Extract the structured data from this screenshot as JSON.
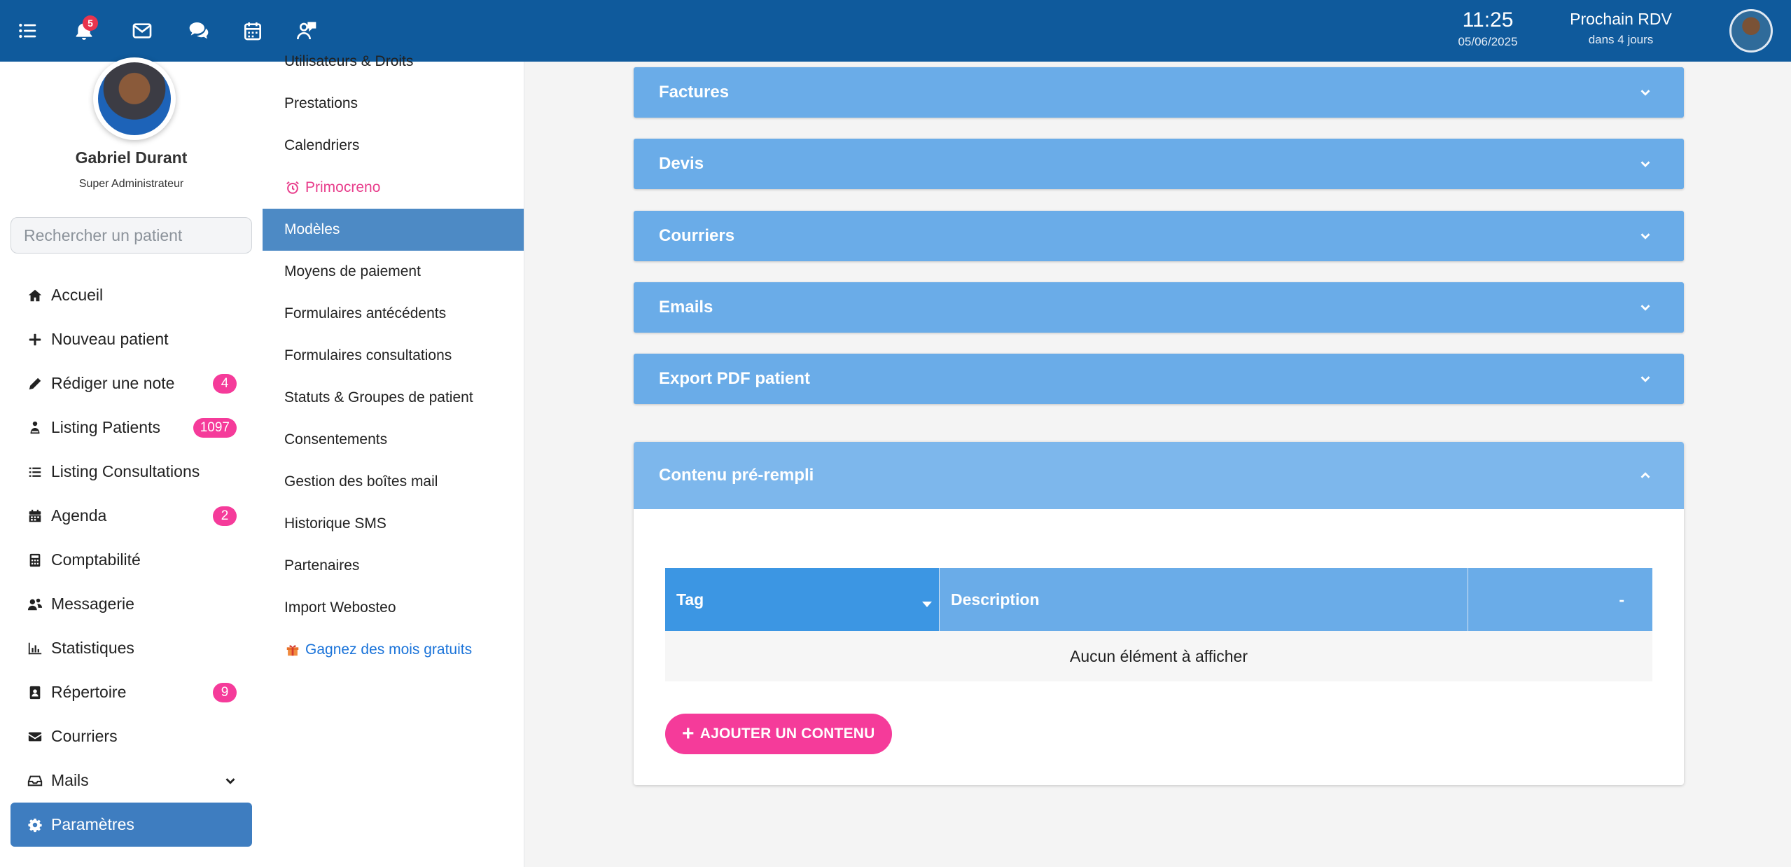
{
  "topbar": {
    "notifications_count": "5",
    "time": "11:25",
    "date": "05/06/2025",
    "next_rdv_label": "Prochain RDV",
    "next_rdv_sub": "dans 4 jours"
  },
  "profile": {
    "name": "Gabriel Durant",
    "role": "Super Administrateur"
  },
  "search": {
    "placeholder": "Rechercher un patient"
  },
  "nav": {
    "items": [
      {
        "label": "Accueil",
        "icon": "home-icon"
      },
      {
        "label": "Nouveau patient",
        "icon": "plus-icon"
      },
      {
        "label": "Rédiger une note",
        "icon": "pencil-icon",
        "badge": "4"
      },
      {
        "label": "Listing Patients",
        "icon": "patient-icon",
        "badge": "1097"
      },
      {
        "label": "Listing Consultations",
        "icon": "list-icon"
      },
      {
        "label": "Agenda",
        "icon": "calendar-icon",
        "badge": "2"
      },
      {
        "label": "Comptabilité",
        "icon": "calculator-icon"
      },
      {
        "label": "Messagerie",
        "icon": "users-icon"
      },
      {
        "label": "Statistiques",
        "icon": "chart-icon"
      },
      {
        "label": "Répertoire",
        "icon": "contact-book-icon",
        "badge": "9"
      },
      {
        "label": "Courriers",
        "icon": "envelope-icon"
      },
      {
        "label": "Mails",
        "icon": "inbox-icon"
      },
      {
        "label": "Paramètres",
        "icon": "gear-icon"
      }
    ]
  },
  "submenu": {
    "items": [
      "Utilisateurs & Droits",
      "Prestations",
      "Calendriers",
      "Primocreno",
      "Modèles",
      "Moyens de paiement",
      "Formulaires antécédents",
      "Formulaires consultations",
      "Statuts & Groupes de patient",
      "Consentements",
      "Gestion des boîtes mail",
      "Historique SMS",
      "Partenaires",
      "Import Webosteo",
      "Gagnez des mois gratuits"
    ]
  },
  "panels": [
    "Factures",
    "Devis",
    "Courriers",
    "Emails",
    "Export PDF patient"
  ],
  "open_panel": {
    "title": "Contenu pré-rempli",
    "table": {
      "columns": [
        "Tag",
        "Description",
        "-"
      ],
      "empty_text": "Aucun élément à afficher"
    },
    "add_button": "AJOUTER UN CONTENU"
  },
  "colors": {
    "topbar": "#0f5a9c",
    "panel": "#6aace8",
    "active_nav": "#3e7dc0",
    "badge": "#f53b9a"
  }
}
